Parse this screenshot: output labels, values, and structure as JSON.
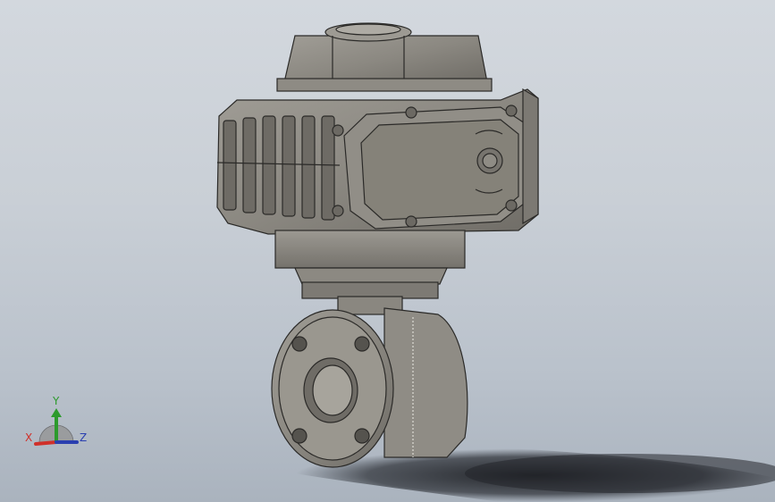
{
  "viewport": {
    "background_top": "#d3d8de",
    "background_bottom": "#aab3be",
    "part_color": "#8a8780",
    "edge_color": "#2b2a28"
  },
  "model": {
    "actuator_icons": [
      "rotation-indicator-icon",
      "arrow-icon"
    ]
  },
  "triad": {
    "x_label": "X",
    "y_label": "Y",
    "z_label": "Z",
    "x_color": "#d0302a",
    "y_color": "#2c9a2c",
    "z_color": "#2a3fb0"
  }
}
